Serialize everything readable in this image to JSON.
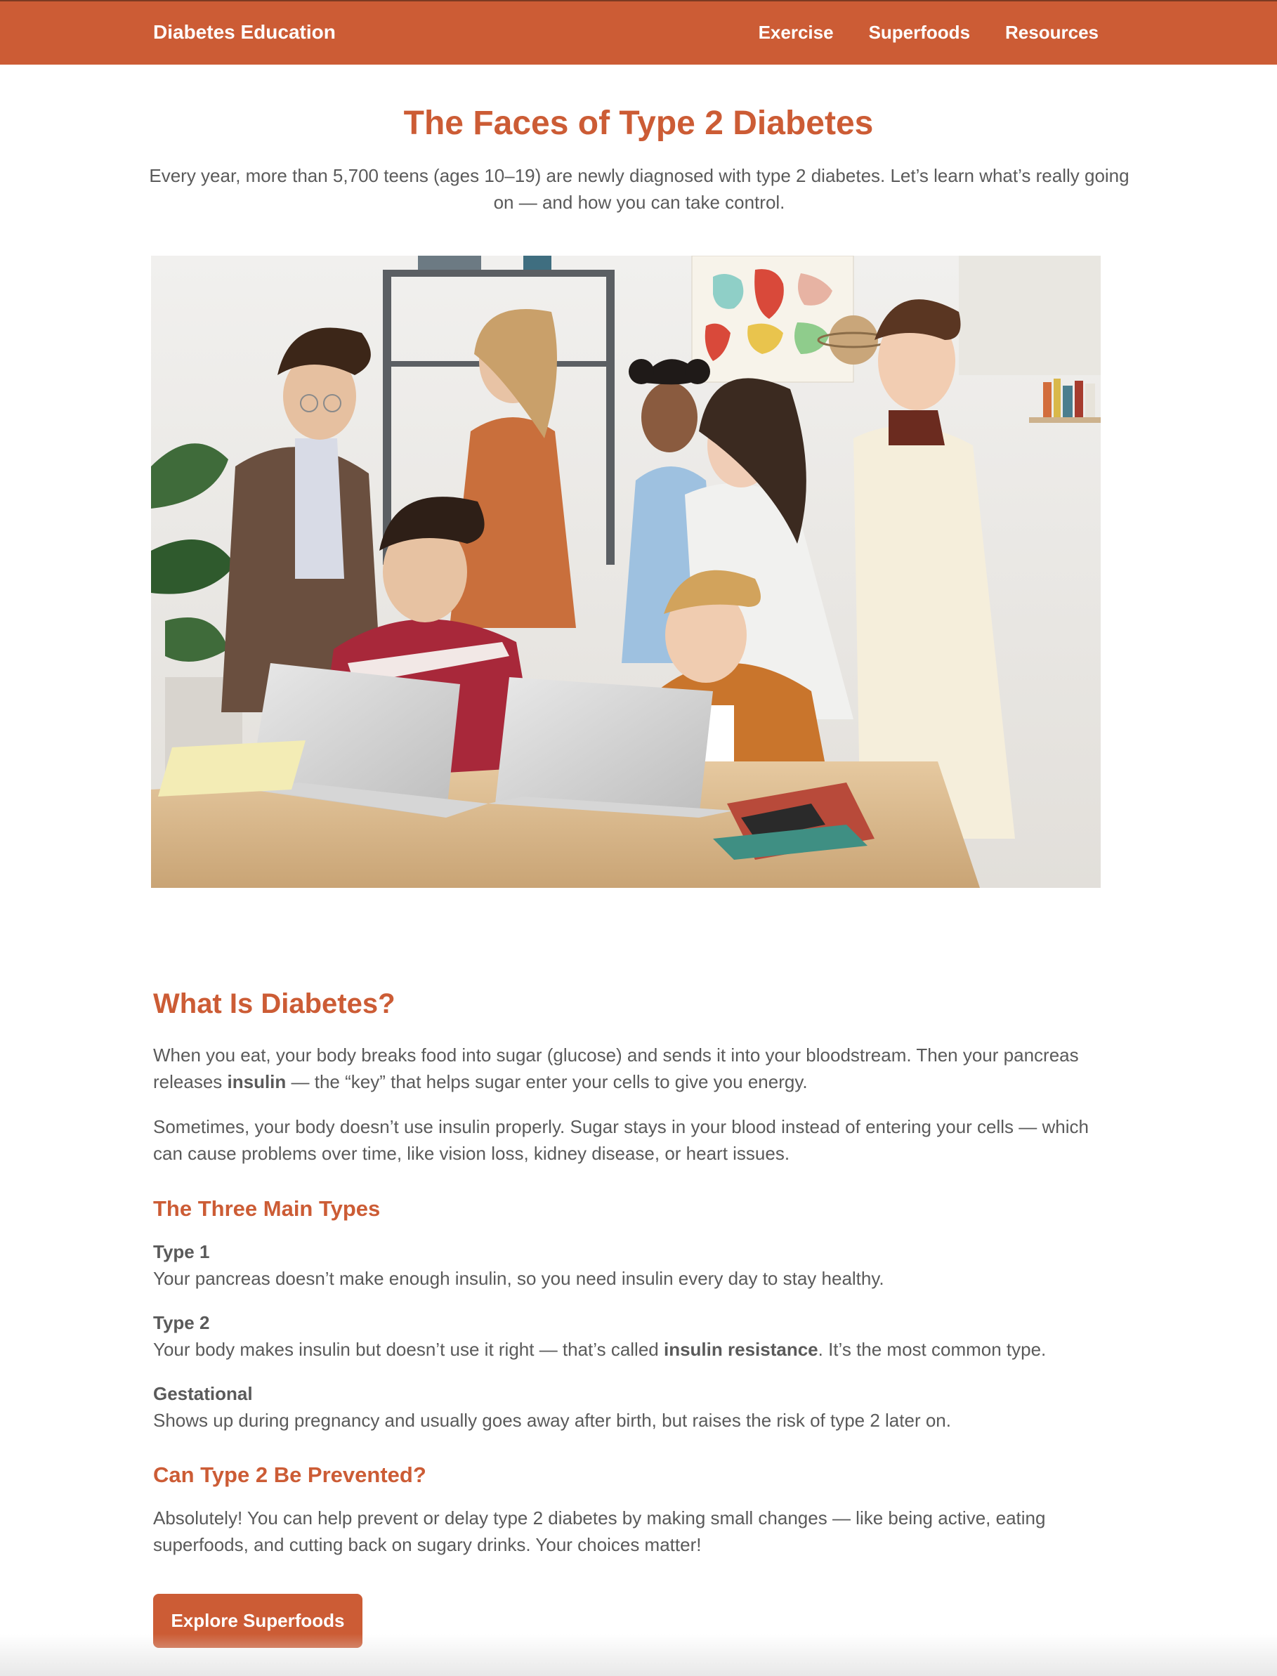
{
  "nav": {
    "brand": "Diabetes Education",
    "links": [
      "Exercise",
      "Superfoods",
      "Resources"
    ]
  },
  "hero": {
    "title": "The Faces of Type 2 Diabetes",
    "subtitle_line1": "Every year, more than 5,700 teens (ages 10–19) are newly diagnosed with type 2 diabetes. Let’s learn what’s really going",
    "subtitle_line2": "on — and how you can take control."
  },
  "what_is": {
    "heading": "What Is Diabetes?",
    "p1_a": "When you eat, your body breaks food into sugar (glucose) and sends it into your bloodstream. Then your pancreas releases ",
    "p1_bold": "insulin",
    "p1_b": " — the “key” that helps sugar enter your cells to give you energy.",
    "p2": "Sometimes, your body doesn’t use insulin properly. Sugar stays in your blood instead of entering your cells — which can cause problems over time, like vision loss, kidney disease, or heart issues."
  },
  "types": {
    "heading": "The Three Main Types",
    "items": [
      {
        "name": "Type 1",
        "desc": "Your pancreas doesn’t make enough insulin, so you need insulin every day to stay healthy."
      },
      {
        "name": "Type 2",
        "desc_a": "Your body makes insulin but doesn’t use it right — that’s called ",
        "desc_bold": "insulin resistance",
        "desc_b": ". It’s the most common type."
      },
      {
        "name": "Gestational",
        "desc": "Shows up during pregnancy and usually goes away after birth, but raises the risk of type 2 later on."
      }
    ]
  },
  "prevent": {
    "heading": "Can Type 2 Be Prevented?",
    "text": "Absolutely! You can help prevent or delay type 2 diabetes by making small changes — like being active, eating superfoods, and cutting back on sugary drinks. Your choices matter!"
  },
  "cta": {
    "label": "Explore Superfoods"
  },
  "colors": {
    "accent": "#cc5c35",
    "text": "#5a5a5a"
  }
}
